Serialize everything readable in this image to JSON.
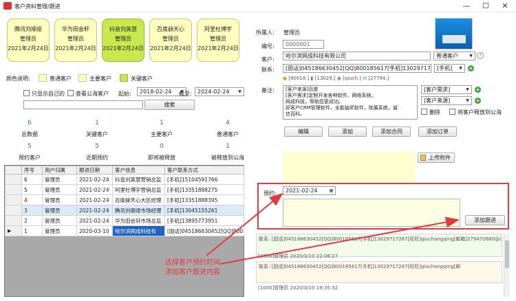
{
  "window": {
    "title": "客户资料管理/跟进",
    "min": "—",
    "max": "☐",
    "close": "✕"
  },
  "cards": [
    {
      "name": "腾讯刘顺娅",
      "owner": "管理员",
      "date": "2021年2月24日",
      "type": "normal"
    },
    {
      "name": "华为田会轩",
      "owner": "管理员",
      "date": "2021年2月24日",
      "type": "main"
    },
    {
      "name": "抖音刘英慧",
      "owner": "管理员",
      "date": "2021年2月24日",
      "type": "key"
    },
    {
      "name": "百度赫天心",
      "owner": "管理员",
      "date": "2021年2月24日",
      "type": "normal"
    },
    {
      "name": "阿里杜博宇",
      "owner": "管理员",
      "date": "2021年2月24日",
      "type": "normal"
    }
  ],
  "legend": {
    "label": "颜色说明:",
    "normal": "普通客户",
    "main": "主要客户",
    "key": "关键客户"
  },
  "filters": {
    "only_mine": "只显示自己的",
    "view_public": "查看公海客户",
    "start_label": "起始:",
    "start_date": "2018-02-24",
    "end_label": "截至:",
    "end_date": "2024-02-24",
    "search_button": "搜索"
  },
  "stats": [
    {
      "value": "6",
      "label": "总数据"
    },
    {
      "value": "1",
      "label": "关键客户"
    },
    {
      "value": "1",
      "label": "主要客户"
    },
    {
      "value": "4",
      "label": "普通客户"
    },
    {
      "value": "5",
      "label": "预约客户"
    },
    {
      "value": "5",
      "label": "近期预约"
    },
    {
      "value": "0",
      "label": "即将被释放"
    },
    {
      "value": "1",
      "label": "被释放到公海"
    }
  ],
  "table": {
    "columns": [
      "序号",
      "用户归属",
      "跟进日期",
      "客户信息",
      "客户联系方式"
    ],
    "rows": [
      [
        "6",
        "管理员",
        "2021-02-24",
        "抖音刘英慧营销总监",
        "[手机]15104591766"
      ],
      [
        "5",
        "管理员",
        "2021-02-24",
        "阿里杜博宇营销总监",
        "[手机]13351888275"
      ],
      [
        "4",
        "管理员",
        "2021-02-24",
        "百度赫天心大区经理",
        "[手机]13351888395"
      ],
      [
        "3",
        "管理员",
        "2021-02-24",
        "腾讯刘顺娅市场经理",
        "[手机]13045155261"
      ],
      [
        "2",
        "管理员",
        "2021-02-24",
        "华为田会轩市场总监",
        "[手机]13895773951"
      ],
      [
        "1",
        "管理员",
        "2020-03-10",
        "哈尔滨网成科技有",
        "[固话]045186630452[QQ]800185"
      ]
    ]
  },
  "detail": {
    "owner_label": "所属人:",
    "owner": "管理员",
    "id_label": "编号:",
    "id": "0000001",
    "customer_label": "客户:",
    "customer": "哈尔滨网成科技有限公司",
    "customer_type": "普通客户",
    "contact_label": "联系:",
    "contact": "[固话]045186630452[QQ]800185617[手机]13029717267[旺旺]qi",
    "contact_type": "[手机]",
    "contact_chips": [
      "[80018.]",
      "[13029.]",
      "[qiuch.]",
      "[27794.]"
    ],
    "remark_label": "备注:",
    "remark_lines": [
      "[客户来源]百度",
      "[客户需求]定制开发各种软件、网络系统。",
      "网成科技，帮助您更成功。",
      "好客户CRM管理软件，全能抽奖软件，姓展系统，诚",
      "信百科。"
    ],
    "need_select": "[客户需求]",
    "source_select": "[客户来源]",
    "delete_label": "删除",
    "release_label": "将客户释放到公海",
    "buttons": {
      "edit": "编辑",
      "add": "添加",
      "add_contract": "添加合同",
      "add_order": "添加订单"
    },
    "upload": "上传附件",
    "appointment_label": "预约:",
    "appointment_date": "2021-02-24",
    "add_followup": "添加跟进"
  },
  "logs": [
    {
      "contact": "联系: [固话]045186630452[QQ]800185617[手机]13029717267[旺旺]qiuchangqing[邮箱]279470880@qq.com",
      "meta": "[1000]管理员  2020/3/10 22:06:27"
    },
    {
      "contact": "联系: [固话]045186630452[QQ]800185617[手机]13029717267[旺旺]qiuchangqing[邮",
      "meta": "[1000]管理员  2020/3/10 19:35:32"
    }
  ],
  "annotation": {
    "line1": "选择客户预约时间",
    "line2": "添加客户跟进内容"
  },
  "colors": {
    "normal": "#ffffc0",
    "key": "#c9e84e",
    "highlight": "#1e62c8",
    "annotation": "#e8383d"
  }
}
